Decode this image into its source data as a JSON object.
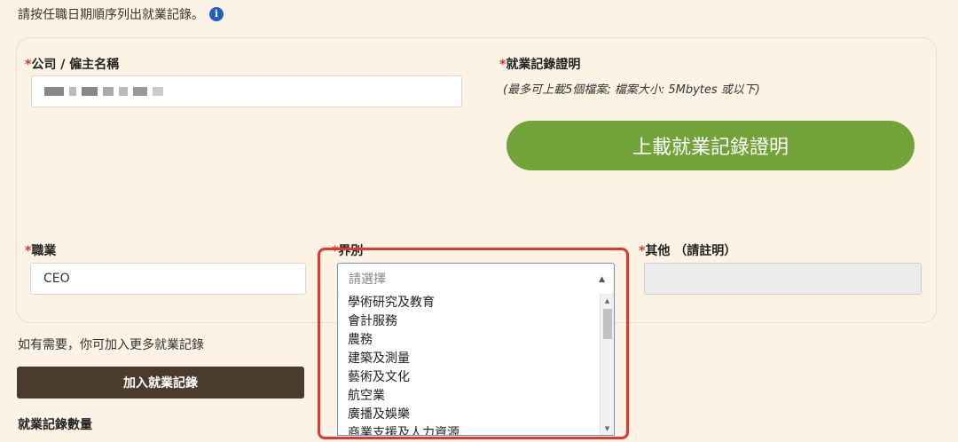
{
  "instruction": "請按任職日期順序列出就業記錄。",
  "company": {
    "required_mark": "*",
    "label": "公司 / 僱主名稱"
  },
  "proof": {
    "required_mark": "*",
    "label": "就業記錄證明",
    "note": "(最多可上載5個檔案; 檔案大小: 5Mbytes 或以下)",
    "upload_label": "上載就業記錄證明"
  },
  "occupation": {
    "required_mark": "*",
    "label": "職業",
    "value": "CEO"
  },
  "sector": {
    "required_mark": "*",
    "label": "界別",
    "placeholder": "請選擇",
    "options": [
      "學術研究及教育",
      "會計服務",
      "農務",
      "建築及測量",
      "藝術及文化",
      "航空業",
      "廣播及娛樂",
      "商業支援及人力資源"
    ]
  },
  "other": {
    "required_mark": "*",
    "label": "其他 （請註明）",
    "value": ""
  },
  "more_records_text": "如有需要，你可加入更多就業記錄",
  "add_button_label": "加入就業記錄",
  "record_count_label": "就業記錄數量",
  "colors": {
    "accent_green": "#72a338",
    "brown_button": "#4b3b2c",
    "required": "#e0342c",
    "highlight_border": "#e23a2a",
    "info_blue": "#1f5fbf"
  }
}
